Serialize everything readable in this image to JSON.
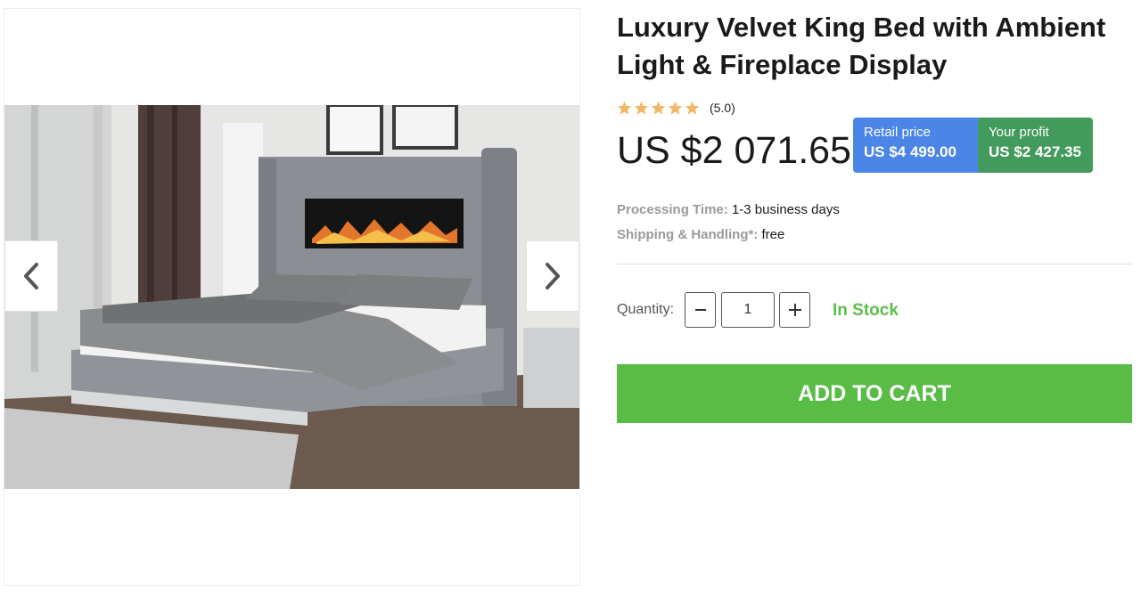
{
  "product": {
    "title": "Luxury Velvet King Bed with Ambient Light & Fireplace Display",
    "rating": {
      "stars": 5,
      "value_text": "(5.0)",
      "star_color": "#f0b866"
    },
    "price": "US $2 071.65",
    "retail": {
      "label": "Retail price",
      "value": "US $4 499.00",
      "color": "#4c85e8"
    },
    "profit": {
      "label": "Your profit",
      "value": "US $2 427.35",
      "color": "#429a5c"
    },
    "processing": {
      "label": "Processing Time:",
      "value": "1-3 business days"
    },
    "shipping": {
      "label": "Shipping & Handling*:",
      "value": "free"
    }
  },
  "quantity": {
    "label": "Quantity:",
    "value": "1",
    "stock": "In Stock",
    "stock_color": "#5cbf4a"
  },
  "cart": {
    "label": "ADD TO CART",
    "color": "#58bc45"
  },
  "gallery": {
    "prev_icon": "chevron-left-icon",
    "next_icon": "chevron-right-icon"
  }
}
